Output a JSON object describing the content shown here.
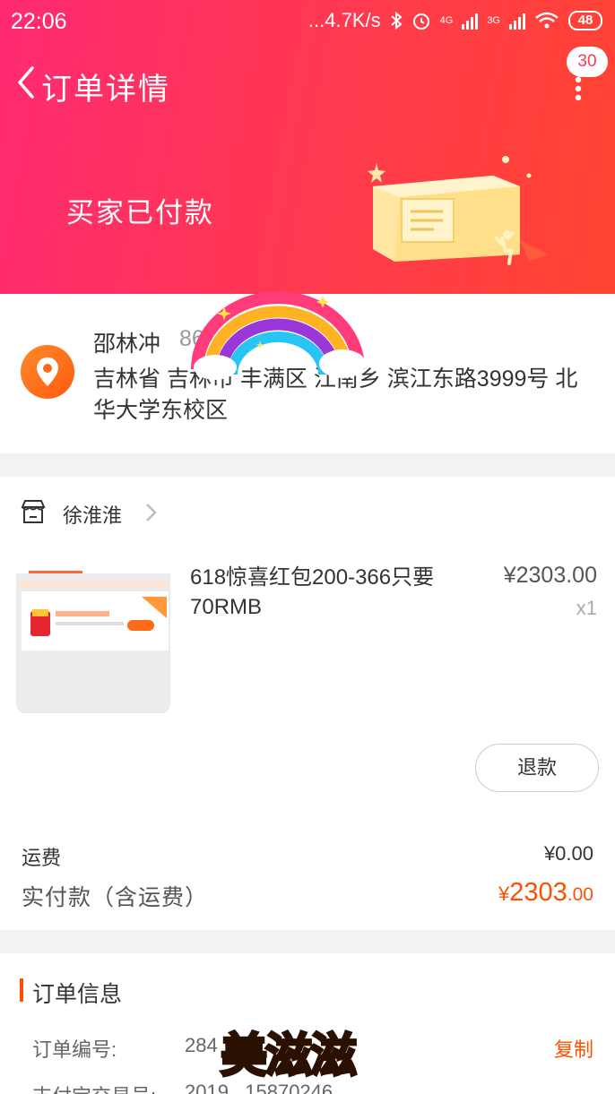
{
  "status_bar": {
    "time": "22:06",
    "net_speed": "...4.7K/s",
    "battery": "48",
    "sig1_label": "4G",
    "sig2_label": "3G"
  },
  "nav": {
    "title": "订单详情",
    "message_count": "30"
  },
  "order_status": {
    "title": "买家已付款"
  },
  "address": {
    "name": "邵林冲",
    "phone_partial": "86",
    "detail": "吉林省 吉林市 丰满区 江南乡 滨江东路3999号 北华大学东校区"
  },
  "shop": {
    "name": "徐淮淮"
  },
  "item": {
    "title": "618惊喜红包200-366只要70RMB",
    "price": "¥2303.00",
    "quantity": "x1",
    "refund_label": "退款"
  },
  "totals": {
    "shipping_label": "运费",
    "shipping_value": "¥0.00",
    "paid_label": "实付款（含运费）",
    "paid_currency": "¥",
    "paid_int": "2303",
    "paid_dec": ".00"
  },
  "order_info": {
    "title": "订单信息",
    "rows": [
      {
        "label": "订单编号:",
        "value": "284"
      },
      {
        "label": "支付宝交易号:",
        "value": "2019...15870246"
      }
    ],
    "copy_label": "复制"
  },
  "sticker": {
    "text": "美滋滋"
  },
  "colors": {
    "accent": "#ff5000",
    "header_start": "#ff2a72",
    "header_end": "#ff4430"
  }
}
